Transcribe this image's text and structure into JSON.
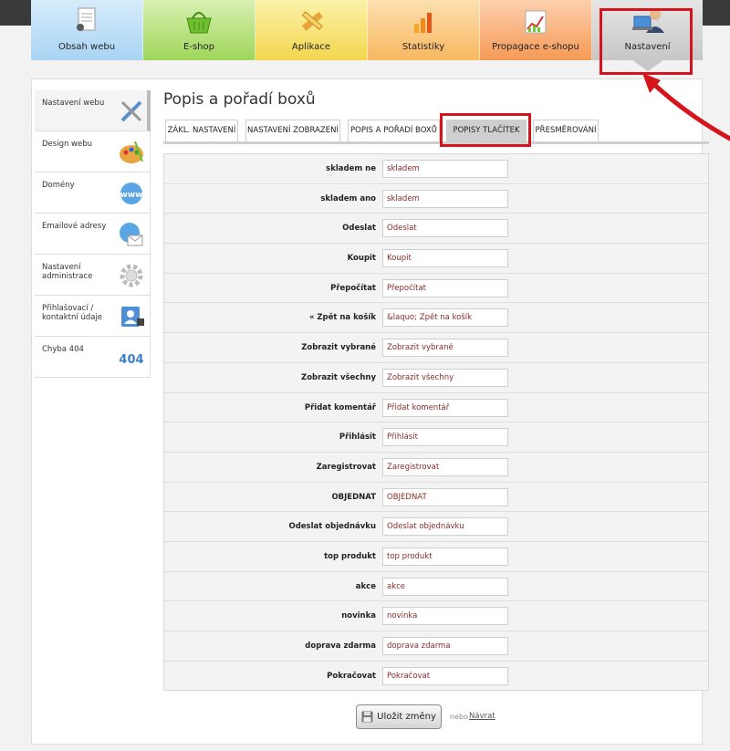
{
  "nav": {
    "tabs": [
      {
        "label": "Obsah webu",
        "icon": "document-icon"
      },
      {
        "label": "E-shop",
        "icon": "basket-icon"
      },
      {
        "label": "Aplikace",
        "icon": "pencil-ruler-icon"
      },
      {
        "label": "Statistiky",
        "icon": "bar-chart-icon"
      },
      {
        "label": "Propagace e-shopu",
        "icon": "growth-chart-icon"
      },
      {
        "label": "Nastavení",
        "icon": "user-laptop-icon"
      }
    ]
  },
  "sidebar": {
    "items": [
      {
        "label": "Nastavení webu",
        "icon": "tools-icon"
      },
      {
        "label": "Design webu",
        "icon": "palette-icon"
      },
      {
        "label": "Domény",
        "icon": "www-globe-icon"
      },
      {
        "label": "Emailové adresy",
        "icon": "email-globe-icon"
      },
      {
        "label": "Nastavení administrace",
        "icon": "gear-icon"
      },
      {
        "label": "Přihlašovací / kontaktní údaje",
        "icon": "contact-card-icon"
      },
      {
        "label": "Chyba 404",
        "icon": "error-404-icon"
      }
    ]
  },
  "page": {
    "title": "Popis a pořadí boxů"
  },
  "subtabs": [
    "ZÁKL. NASTAVENÍ",
    "NASTAVENÍ ZOBRAZENÍ",
    "POPIS A POŘADÍ BOXŮ",
    "POPISY TLAČÍTEK",
    "PŘESMĚROVÁNÍ"
  ],
  "fields": [
    {
      "label": "skladem ne",
      "value": "skladem"
    },
    {
      "label": "skladem ano",
      "value": "skladem"
    },
    {
      "label": "Odeslat",
      "value": "Odeslat"
    },
    {
      "label": "Koupit",
      "value": "Koupit"
    },
    {
      "label": "Přepočítat",
      "value": "Přepočítat"
    },
    {
      "label": "« Zpět na košík",
      "value": "&laquo; Zpět na košík"
    },
    {
      "label": "Zobrazit vybrané",
      "value": "Zobrazit vybrané"
    },
    {
      "label": "Zobrazit všechny",
      "value": "Zobrazit všechny"
    },
    {
      "label": "Přidat komentář",
      "value": "Přidat komentář"
    },
    {
      "label": "Přihlásit",
      "value": "Přihlásit"
    },
    {
      "label": "Zaregistrovat",
      "value": "Zaregistrovat"
    },
    {
      "label": "OBJEDNAT",
      "value": "OBJEDNAT"
    },
    {
      "label": "Odeslat objednávku",
      "value": "Odeslat objednávku"
    },
    {
      "label": "top produkt",
      "value": "top produkt"
    },
    {
      "label": "akce",
      "value": "akce"
    },
    {
      "label": "novinka",
      "value": "novinka"
    },
    {
      "label": "doprava zdarma",
      "value": "doprava zdarma"
    },
    {
      "label": "Pokračovat",
      "value": "Pokračovat"
    }
  ],
  "actions": {
    "save_label": "Uložit změny",
    "or_text": "nebo",
    "back_label": "Návrat"
  },
  "colors": {
    "highlight": "#d6141c",
    "input_text": "#8b2a2a"
  }
}
